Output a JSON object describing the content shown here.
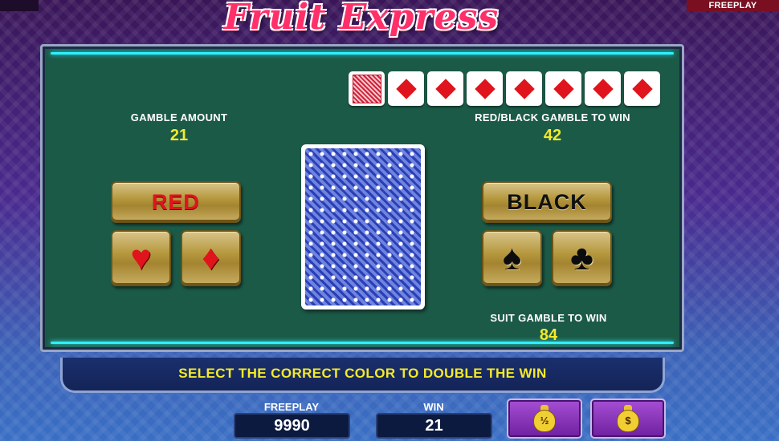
{
  "top_bar": {
    "freeplay_tag": "FREEPLAY"
  },
  "logo": {
    "text": "Fruit Express"
  },
  "history": {
    "cards": [
      "back",
      "diamond",
      "diamond",
      "diamond",
      "diamond",
      "diamond",
      "diamond",
      "diamond"
    ]
  },
  "gamble": {
    "amount_label": "GAMBLE AMOUNT",
    "amount_value": "21",
    "red_black_label": "RED/BLACK GAMBLE TO WIN",
    "red_black_value": "42",
    "suit_label": "SUIT GAMBLE TO WIN",
    "suit_value": "84"
  },
  "buttons": {
    "red": "RED",
    "black": "BLACK",
    "hearts_icon": "heart-icon",
    "diamonds_icon": "diamond-icon",
    "spades_icon": "spade-icon",
    "clubs_icon": "club-icon"
  },
  "message": "SELECT THE CORRECT COLOR TO DOUBLE THE WIN",
  "bottom": {
    "freeplay_label": "FREEPLAY",
    "freeplay_value": "9990",
    "win_label": "WIN",
    "win_value": "21",
    "half_collect_icon": "money-bag-half-icon",
    "collect_icon": "money-bag-dollar-icon"
  },
  "colors": {
    "accent_yellow": "#f4ea2a",
    "table_green": "#1c5a48",
    "card_red": "#e0141c"
  }
}
